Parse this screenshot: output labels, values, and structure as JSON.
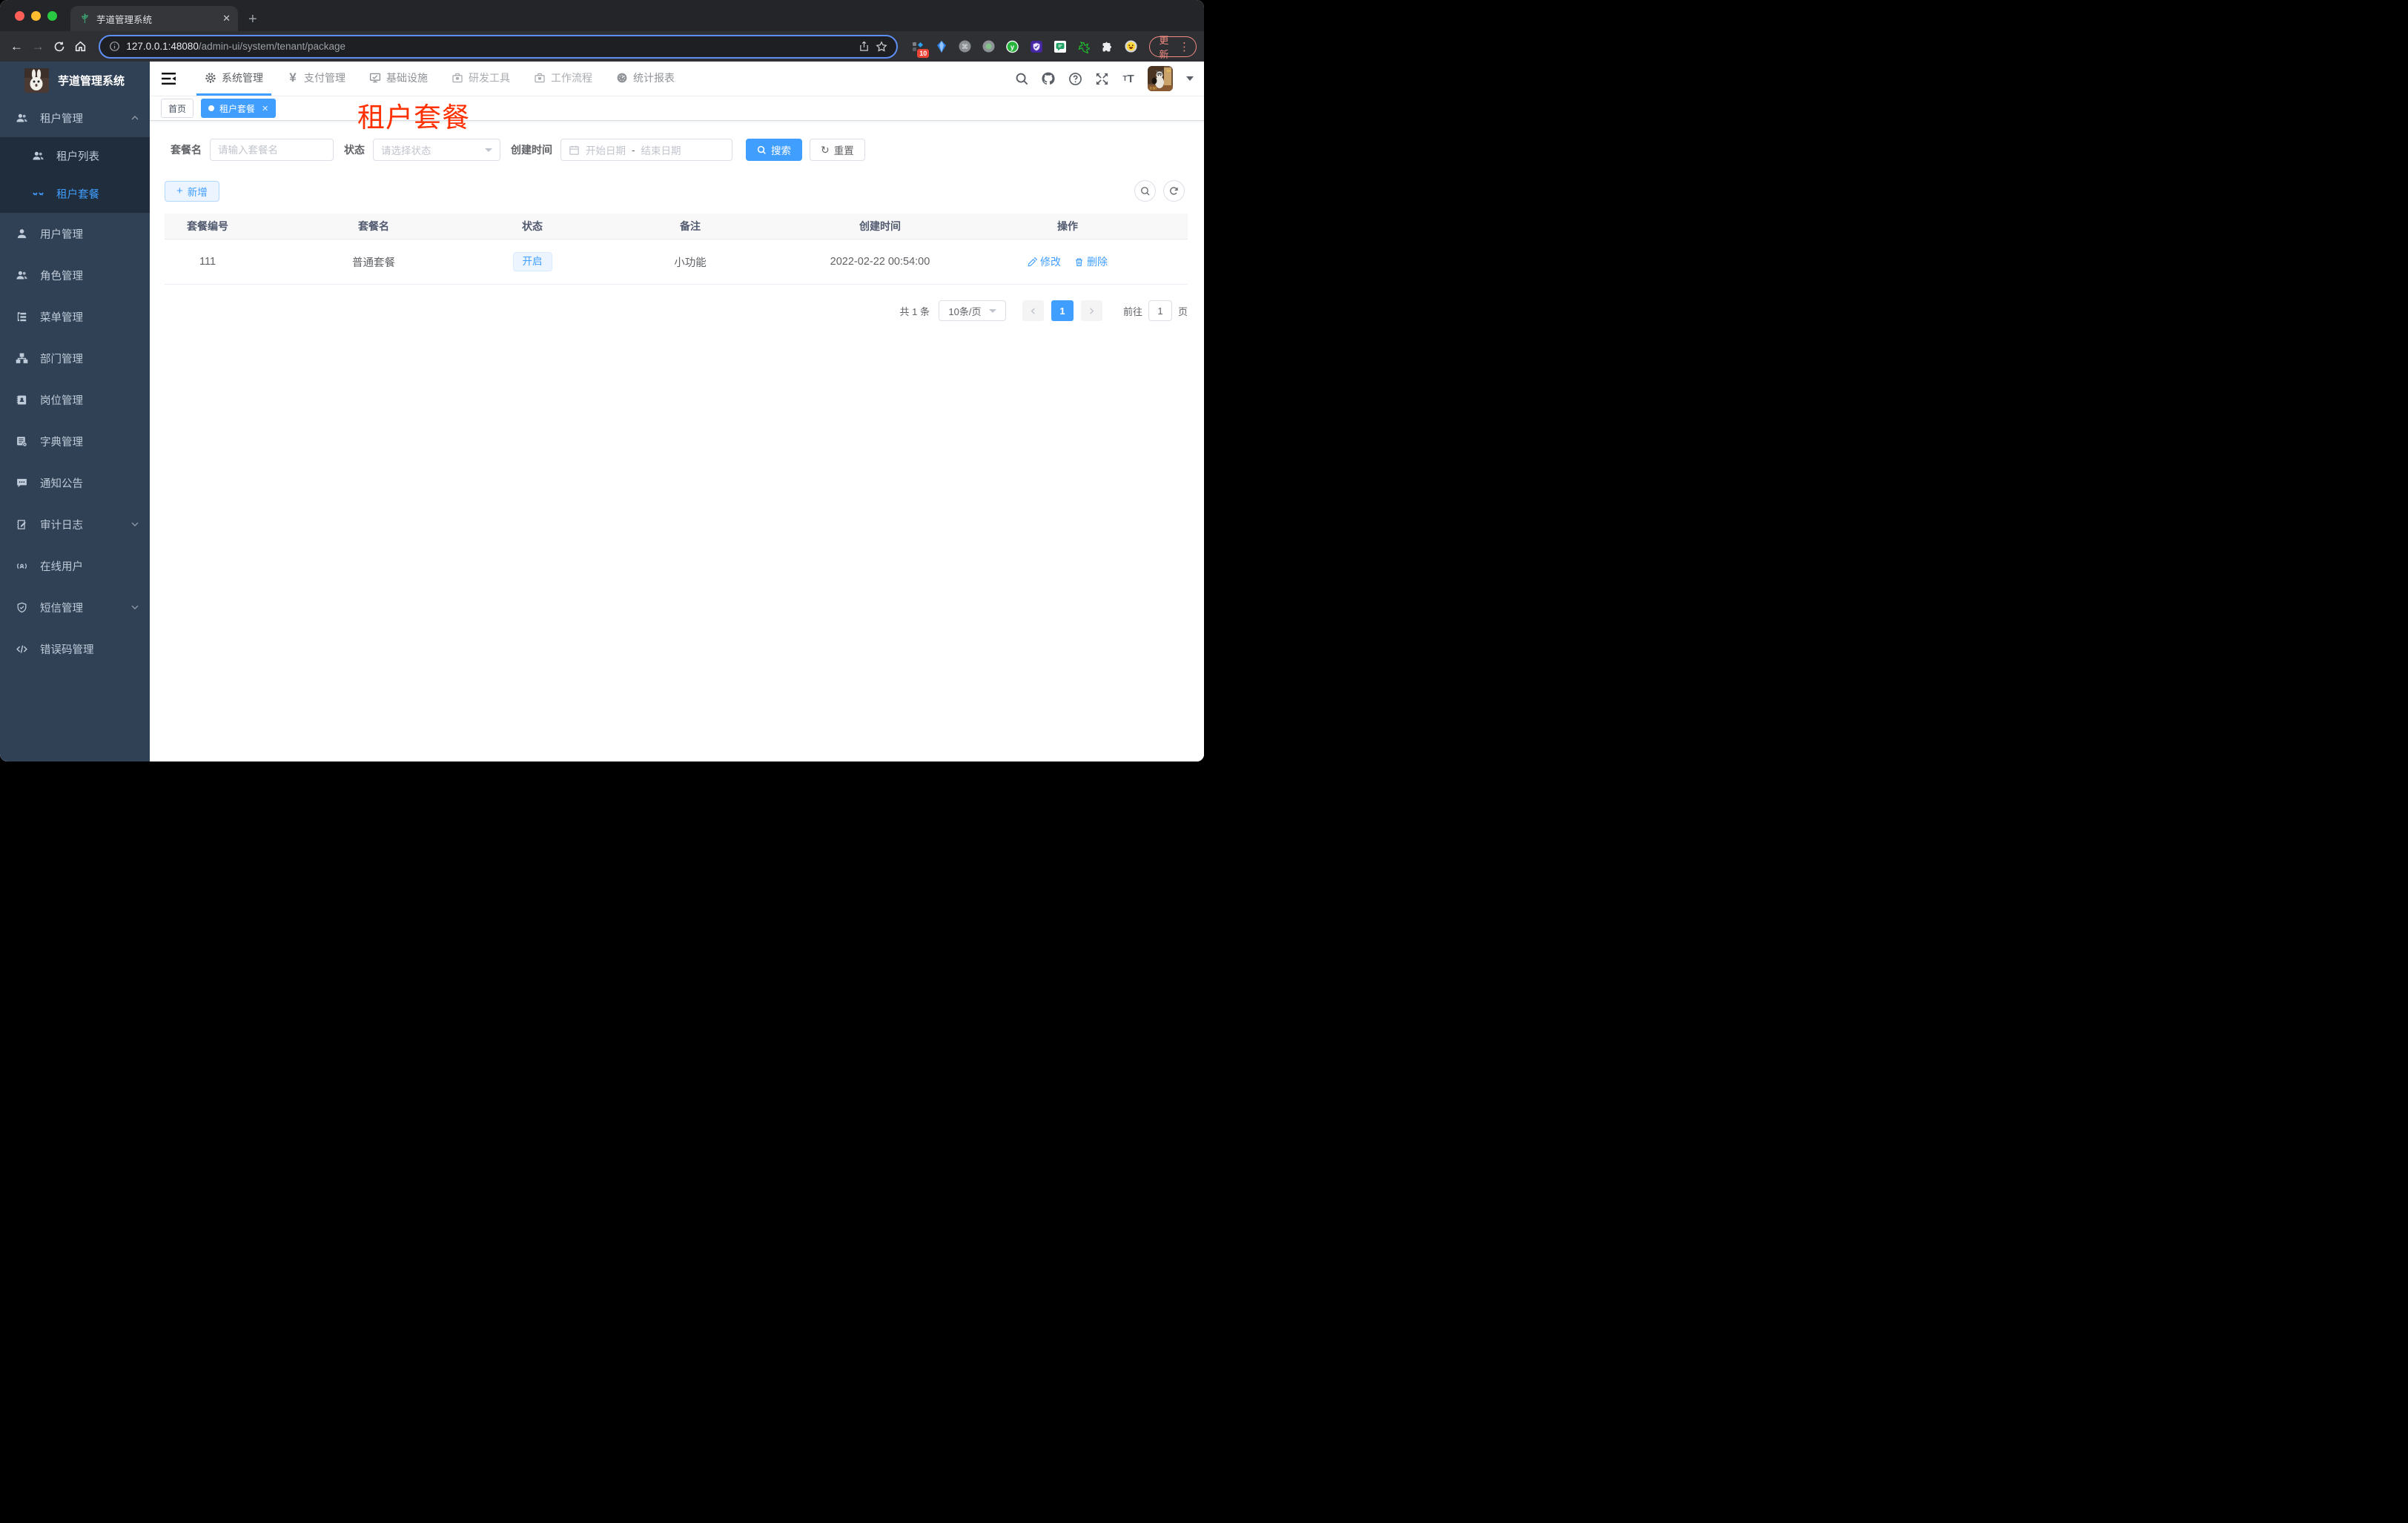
{
  "browser": {
    "tab_title": "芋道管理系统",
    "url_host": "127.0.0.1:48080",
    "url_path": "/admin-ui/system/tenant/package",
    "extension_badge": "10",
    "update_label": "更新"
  },
  "header": {
    "nav": [
      {
        "icon": "gear-icon",
        "label": "系统管理"
      },
      {
        "icon": "yen-icon",
        "label": "支付管理"
      },
      {
        "icon": "monitor-icon",
        "label": "基础设施"
      },
      {
        "icon": "toolbox-icon",
        "label": "研发工具"
      },
      {
        "icon": "toolbox-icon",
        "label": "工作流程"
      },
      {
        "icon": "dashboard-icon",
        "label": "统计报表"
      }
    ],
    "right_icons": [
      "search-icon",
      "github-icon",
      "help-icon",
      "fullscreen-icon",
      "font-size-icon",
      "avatar",
      "caret-down-icon"
    ]
  },
  "sidebar": {
    "title": "芋道管理系统",
    "items": [
      {
        "icon": "users-icon",
        "label": "租户管理",
        "state": "expanded"
      },
      {
        "icon": "users-icon",
        "label": "租户列表",
        "level": 2
      },
      {
        "icon": "lashes-icon",
        "label": "租户套餐",
        "level": 2,
        "state": "active"
      },
      {
        "icon": "user-icon",
        "label": "用户管理"
      },
      {
        "icon": "users-icon",
        "label": "角色管理"
      },
      {
        "icon": "tree-list-icon",
        "label": "菜单管理"
      },
      {
        "icon": "org-tree-icon",
        "label": "部门管理"
      },
      {
        "icon": "id-badge-icon",
        "label": "岗位管理"
      },
      {
        "icon": "dict-book-icon",
        "label": "字典管理"
      },
      {
        "icon": "message-icon",
        "label": "通知公告"
      },
      {
        "icon": "audit-log-icon",
        "label": "审计日志",
        "state": "collapsed"
      },
      {
        "icon": "online-user-icon",
        "label": "在线用户"
      },
      {
        "icon": "sms-shield-icon",
        "label": "短信管理",
        "state": "collapsed"
      },
      {
        "icon": "error-code-icon",
        "label": "错误码管理"
      }
    ]
  },
  "tabs": {
    "home_label": "首页",
    "active_label": "租户套餐"
  },
  "overlay_title": "租户套餐",
  "filters": {
    "name_label": "套餐名",
    "name_placeholder": "请输入套餐名",
    "status_label": "状态",
    "status_placeholder": "请选择状态",
    "created_label": "创建时间",
    "date_start_placeholder": "开始日期",
    "date_separator": "-",
    "date_end_placeholder": "结束日期",
    "search_label": "搜索",
    "reset_label": "重置"
  },
  "toolbar": {
    "add_label": "新增"
  },
  "table": {
    "columns": [
      "套餐编号",
      "套餐名",
      "状态",
      "备注",
      "创建时间",
      "操作"
    ],
    "rows": [
      {
        "id": "111",
        "name": "普通套餐",
        "status": "开启",
        "remark": "小功能",
        "created_at": "2022-02-22 00:54:00"
      }
    ],
    "edit_label": "修改",
    "delete_label": "删除"
  },
  "pagination": {
    "total": "共 1 条",
    "page_size": "10条/页",
    "current_page": "1",
    "goto_label": "前往",
    "goto_value": "1",
    "unit_label": "页"
  },
  "colors": {
    "accent": "#409eff",
    "sidebar_bg": "#304156",
    "submenu_bg": "#1f2d3d",
    "overlay_red": "#ff3000",
    "tag_bg": "#ecf5ff",
    "tag_border": "#d9ecff",
    "update_red": "#f28b82",
    "active_page_bg": "#409eff"
  }
}
